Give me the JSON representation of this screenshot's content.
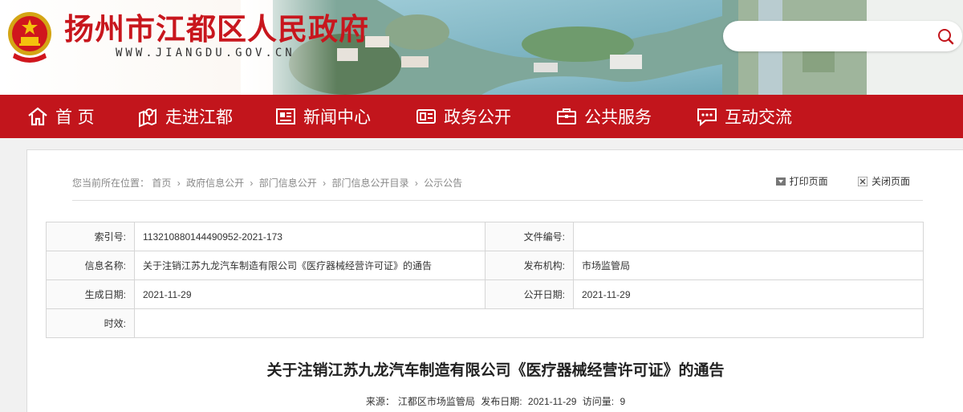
{
  "header": {
    "title": "扬州市江都区人民政府",
    "url": "WWW.JIANGDU.GOV.CN",
    "search": {
      "placeholder": "",
      "icon": "search-icon"
    },
    "colors": {
      "brand_red": "#c2151c",
      "title_red": "#c8161d"
    }
  },
  "nav": {
    "items": [
      {
        "label": "首 页",
        "icon": "home-icon"
      },
      {
        "label": "走进江都",
        "icon": "map-pin-icon"
      },
      {
        "label": "新闻中心",
        "icon": "newspaper-icon"
      },
      {
        "label": "政务公开",
        "icon": "government-icon"
      },
      {
        "label": "公共服务",
        "icon": "briefcase-icon"
      },
      {
        "label": "互动交流",
        "icon": "chat-icon"
      }
    ]
  },
  "breadcrumb": {
    "prefix": "您当前所在位置：",
    "items": [
      "首页",
      "政府信息公开",
      "部门信息公开",
      "部门信息公开目录",
      "公示公告"
    ],
    "separator": "›"
  },
  "tools": {
    "print": "打印页面",
    "close": "关闭页面"
  },
  "info": {
    "index_label": "索引号:",
    "index_value": "113210880144490952-2021-173",
    "docno_label": "文件编号:",
    "docno_value": "",
    "name_label": "信息名称:",
    "name_value": "关于注销江苏九龙汽车制造有限公司《医疗器械经营许可证》的通告",
    "org_label": "发布机构:",
    "org_value": "市场监管局",
    "created_label": "生成日期:",
    "created_value": "2021-11-29",
    "public_label": "公开日期:",
    "public_value": "2021-11-29",
    "validity_label": "时效:",
    "validity_value": ""
  },
  "article": {
    "title": "关于注销江苏九龙汽车制造有限公司《医疗器械经营许可证》的通告",
    "source_label": "来源：",
    "source_value": "江都区市场监管局",
    "date_label": "发布日期:",
    "date_value": "2021-11-29",
    "views_label": "访问量:",
    "views_value": "9"
  }
}
